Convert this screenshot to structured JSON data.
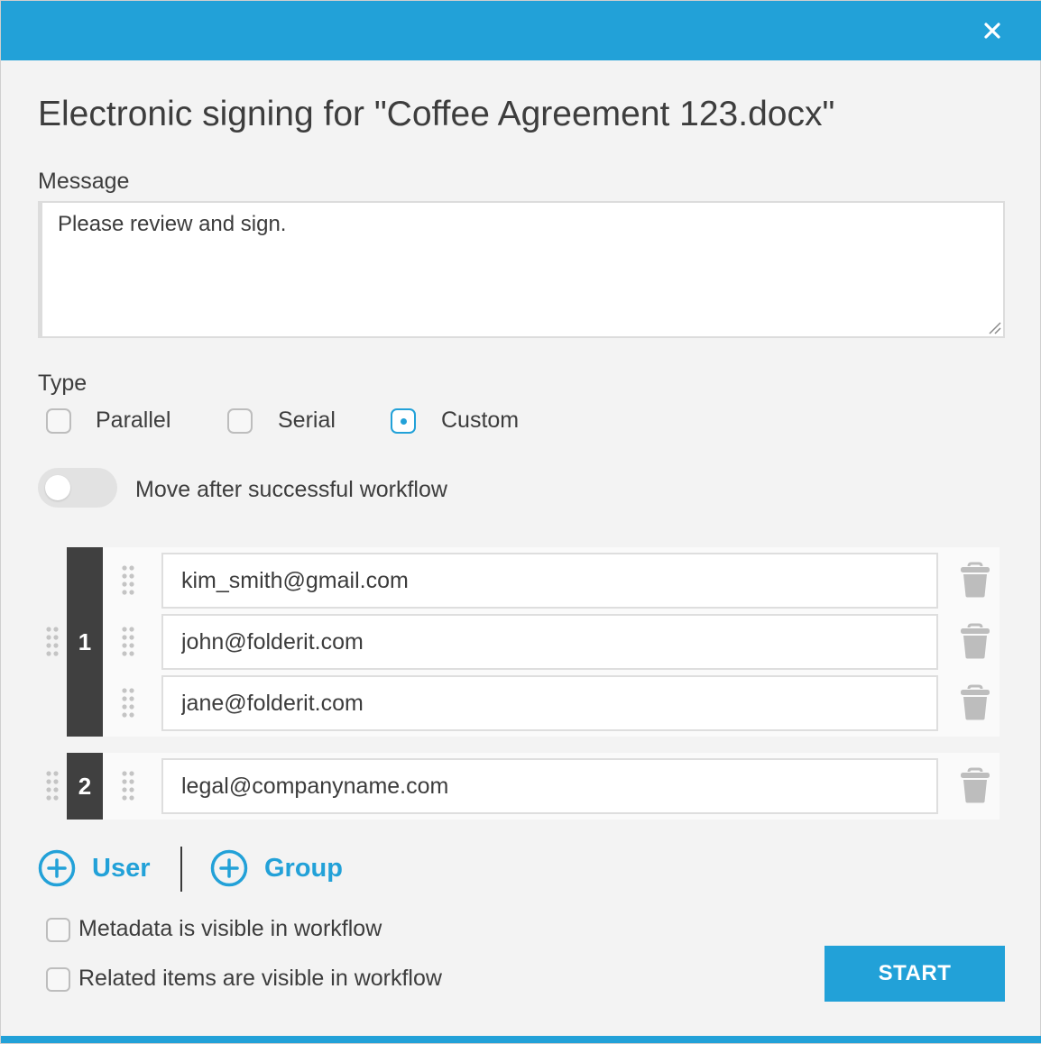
{
  "dialog": {
    "title": "Electronic signing for \"Coffee Agreement 123.docx\"",
    "close_icon": "close-icon",
    "accent_color": "#22a1d8"
  },
  "message": {
    "label": "Message",
    "value": "Please review and sign."
  },
  "type": {
    "label": "Type",
    "options": [
      {
        "label": "Parallel",
        "selected": false
      },
      {
        "label": "Serial",
        "selected": false
      },
      {
        "label": "Custom",
        "selected": true
      }
    ]
  },
  "move_toggle": {
    "label": "Move after successful workflow",
    "on": false
  },
  "groups": [
    {
      "number": "1",
      "users": [
        "kim_smith@gmail.com",
        "john@folderit.com",
        "jane@folderit.com"
      ]
    },
    {
      "number": "2",
      "users": [
        "legal@companyname.com"
      ]
    }
  ],
  "actions": {
    "add_user": "User",
    "add_group": "Group",
    "start": "START"
  },
  "options": {
    "metadata_visible": {
      "label": "Metadata is visible in workflow",
      "checked": false
    },
    "related_visible": {
      "label": "Related items are visible in workflow",
      "checked": false
    }
  }
}
